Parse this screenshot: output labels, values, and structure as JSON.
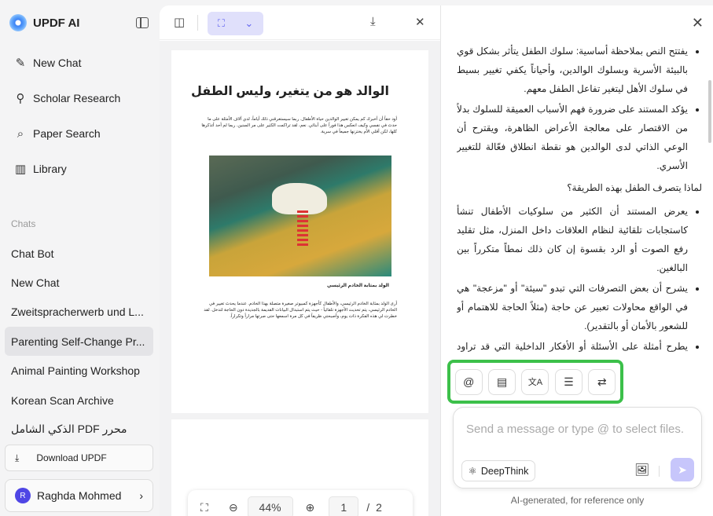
{
  "app": {
    "title": "UPDF AI"
  },
  "sidebar": {
    "items": [
      {
        "label": "New Chat",
        "icon": "✎"
      },
      {
        "label": "Scholar Research",
        "icon": "⚲"
      },
      {
        "label": "Paper Search",
        "icon": "⌕"
      },
      {
        "label": "Library",
        "icon": "▥"
      }
    ],
    "chats_label": "Chats",
    "chats": [
      "Chat Bot",
      "New Chat",
      "Zweitspracherwerb und L...",
      "Parenting Self-Change Pr...",
      "Animal Painting Workshop",
      "Korean Scan Archive",
      "الذكي الشامل PDF محرر"
    ],
    "download": "Download UPDF",
    "user": {
      "initial": "R",
      "name": "Raghda Mohmed"
    }
  },
  "pdf": {
    "title": "الوالد هو من يتغير، وليس الطفل",
    "body": "أود حقاً أن أخبرك كم يمكن تغيير الوالدين حياة الأطفال. ربما سيستغرقني ذلك أياماً، لدي آلاف الأمثلة على ما حدث في نفسي وكيف انعكس هذا فوراً على أبنائي. نعم، لقد تراكمت الكثير على مر السنين. ربما لم أحد أتذكرها كلها، لكن أقلي الأم يختزنها جميعاً في سرية.",
    "caption": "الولد بمثابة الخادم الرئيسي",
    "body2": "أرى الولد بمثابة الخادم الرئيسي، والأطفال كأجهزة كمبيوتر صغيرة متصلة بهذا الخادم. عندما يحدث تغيير في الخادم الرئيسي، يتم تحديث الأجهزة تلقائياً - حيث يتم استبدال البيانات القديمة بالجديدة دون الحاجة لتدخل. لقد خطرت لي هذه الفكرة ذات يوم، وأصبحتي ظريفاً في كل مرة اسمعها حتى صرتها مراراً وتكراراً.",
    "zoom": "44%",
    "page": "1",
    "total": "2",
    "sep": "/"
  },
  "chat": {
    "bullets1": [
      "يفتتح النص بملاحظة أساسية: سلوك الطفل يتأثر بشكل قوي بالبيئة الأسرية وبسلوك الوالدين، وأحياناً يكفي تغيير بسيط في سلوك الأهل ليتغير تفاعل الطفل معهم.",
      "يؤكد المستند على ضرورة فهم الأسباب العميقة للسلوك بدلاً من الاقتصار على معالجة الأعراض الظاهرة، ويقترح أن الوعي الذاتي لدى الوالدين هو نقطة انطلاق فعّالة للتغيير الأسري."
    ],
    "heading": "لماذا يتصرف الطفل بهذه الطريقة؟",
    "bullets2": [
      "يعرض المستند أن الكثير من سلوكيات الأطفال تنشأ كاستجابات تلقائية لنظام العلاقات داخل المنزل، مثل تقليد رفع الصوت أو الرد بقسوة إن كان ذلك نمطاً متكرراً بين البالغين.",
      "يشرح أن بعض التصرفات التي تبدو \"سيئة\" أو \"مزعجة\" هي في الواقع محاولات تعبير عن حاجة (مثلاً الحاجة للاهتمام أو للشعور بالأمان أو بالتقدير).",
      "يطرح أمثلة على الأسئلة أو الأفكار الداخلية التي قد تراود الطفل: هل"
    ],
    "placeholder": "Send a message or type @ to select files.",
    "deepthink": "DeepThink",
    "note": "AI-generated, for reference only",
    "tool_highlight_color": "#3cc04a"
  }
}
